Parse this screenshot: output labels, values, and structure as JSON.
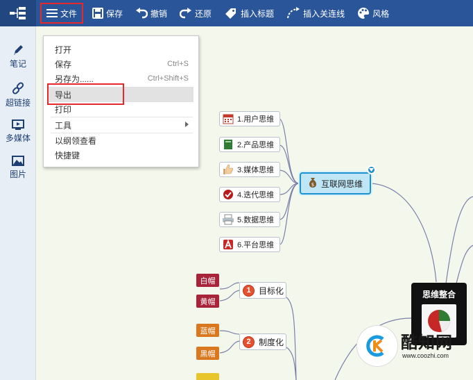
{
  "toolbar": {
    "file": "文件",
    "save": "保存",
    "undo": "撤销",
    "redo": "还原",
    "insert_label": "插入标题",
    "insert_connector": "插入关连线",
    "style": "风格"
  },
  "sidebar": {
    "items": [
      {
        "label": "笔记",
        "icon": "pencil-icon"
      },
      {
        "label": "超链接",
        "icon": "link-icon"
      },
      {
        "label": "多媒体",
        "icon": "media-icon"
      },
      {
        "label": "图片",
        "icon": "image-icon"
      }
    ]
  },
  "file_menu": {
    "open": "打开",
    "save": "保存",
    "save_shortcut": "Ctrl+S",
    "save_as": "另存为......",
    "save_as_shortcut": "Ctrl+Shift+S",
    "export": "导出",
    "print": "打印",
    "tools": "工具",
    "outline_view": "以纲领查看",
    "shortcuts": "快捷键"
  },
  "mindmap": {
    "center": "互联网思维",
    "branches": [
      {
        "label": "1.用户思维",
        "icon": "calendar-icon"
      },
      {
        "label": "2.产品思维",
        "icon": "book-icon"
      },
      {
        "label": "3.媒体思维",
        "icon": "thumbs-up-icon"
      },
      {
        "label": "4.迭代思维",
        "icon": "check-icon"
      },
      {
        "label": "5.数据思维",
        "icon": "printer-icon"
      },
      {
        "label": "6.平台思维",
        "icon": "letter-a-icon"
      }
    ],
    "goal": {
      "number": "1",
      "label": "目标化",
      "tags": [
        "白帽",
        "黄帽"
      ]
    },
    "system": {
      "number": "2",
      "label": "制度化",
      "tags": [
        "蓝帽",
        "黑帽"
      ]
    },
    "summary_title": "思维整合"
  },
  "watermark": {
    "text": "酷知网",
    "url": "www.coozhi.com"
  },
  "colors": {
    "toolbar": "#2a5598",
    "highlight": "#e8272a",
    "center_border": "#1f8fd0",
    "tag_red": "#a8243a",
    "tag_orange": "#d9781f"
  }
}
